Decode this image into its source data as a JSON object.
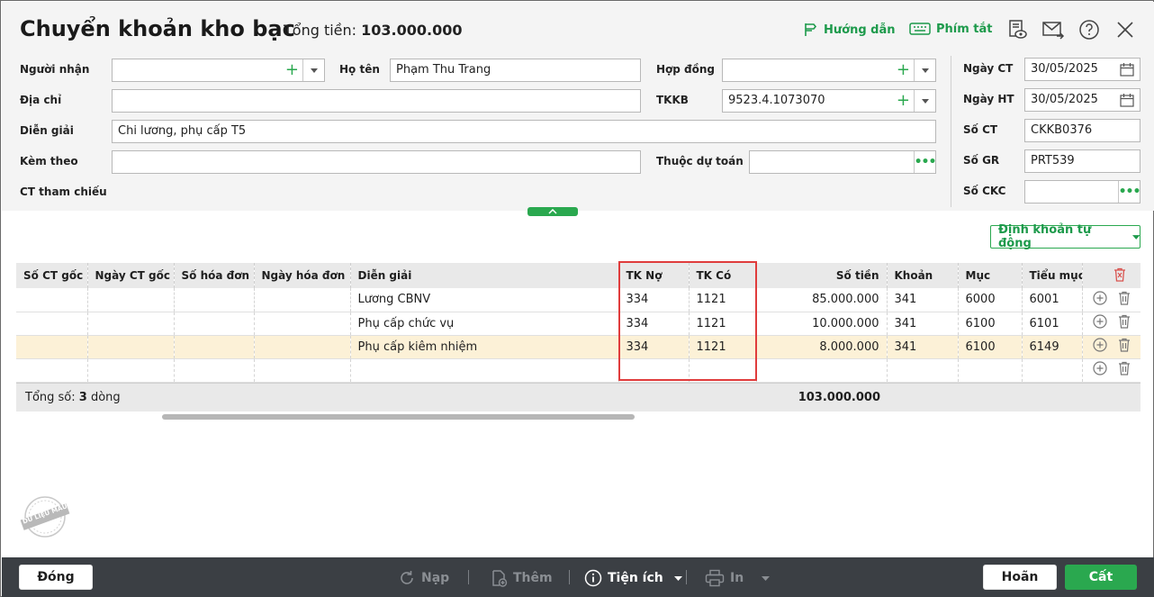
{
  "header": {
    "title": "Chuyển khoản kho bạc",
    "total_label": "Tổng tiền:",
    "total_value": "103.000.000",
    "guide_label": "Hướng dẫn",
    "shortcut_label": "Phím tắt"
  },
  "form": {
    "nguoi_nhan": {
      "label": "Người nhận",
      "value": ""
    },
    "ho_ten": {
      "label": "Họ tên",
      "value": "Phạm Thu Trang"
    },
    "hop_dong": {
      "label": "Hợp đồng",
      "value": ""
    },
    "dia_chi": {
      "label": "Địa chỉ",
      "value": ""
    },
    "tkkb": {
      "label": "TKKB",
      "value": "9523.4.1073070"
    },
    "dien_giai": {
      "label": "Diễn giải",
      "value": "Chi lương, phụ cấp T5"
    },
    "kem_theo": {
      "label": "Kèm theo",
      "value": ""
    },
    "thuoc_du_toan": {
      "label": "Thuộc dự toán",
      "value": ""
    },
    "ct_tham_chieu": {
      "label": "CT tham chiếu"
    },
    "ngay_ct": {
      "label": "Ngày CT",
      "value": "30/05/2025"
    },
    "ngay_ht": {
      "label": "Ngày HT",
      "value": "30/05/2025"
    },
    "so_ct": {
      "label": "Số CT",
      "value": "CKKB0376"
    },
    "so_gr": {
      "label": "Số GR",
      "value": "PRT539"
    },
    "so_ckc": {
      "label": "Số CKC",
      "value": ""
    }
  },
  "auto_entry_label": "Định khoản tự động",
  "table": {
    "columns": [
      "Số CT gốc",
      "Ngày CT gốc",
      "Số hóa đơn",
      "Ngày hóa đơn",
      "Diễn giải",
      "TK Nợ",
      "TK Có",
      "Số tiền",
      "Khoản",
      "Mục",
      "Tiểu mục"
    ],
    "rows": [
      {
        "dien_giai": "Lương CBNV",
        "tk_no": "334",
        "tk_co": "1121",
        "so_tien": "85.000.000",
        "khoan": "341",
        "muc": "6000",
        "tieu_muc": "6001"
      },
      {
        "dien_giai": "Phụ cấp chức vụ",
        "tk_no": "334",
        "tk_co": "1121",
        "so_tien": "10.000.000",
        "khoan": "341",
        "muc": "6100",
        "tieu_muc": "6101"
      },
      {
        "dien_giai": "Phụ cấp kiêm nhiệm",
        "tk_no": "334",
        "tk_co": "1121",
        "so_tien": "8.000.000",
        "khoan": "341",
        "muc": "6100",
        "tieu_muc": "6149"
      }
    ],
    "footer_prefix": "Tổng số: ",
    "footer_count": "3",
    "footer_suffix": " dòng",
    "footer_total": "103.000.000"
  },
  "stamp_text": "DỮ LIỆU MẪU",
  "bottom": {
    "close_label": "Đóng",
    "reload_label": "Nạp",
    "add_label": "Thêm",
    "utility_label": "Tiện ích",
    "print_label": "In",
    "cancel_label": "Hoãn",
    "save_label": "Cất"
  },
  "colors": {
    "accent": "#2aa84f",
    "highlight_row": "#fcf1d7",
    "annotation": "#e03c3c",
    "bottom_bar": "#3b3f44"
  }
}
